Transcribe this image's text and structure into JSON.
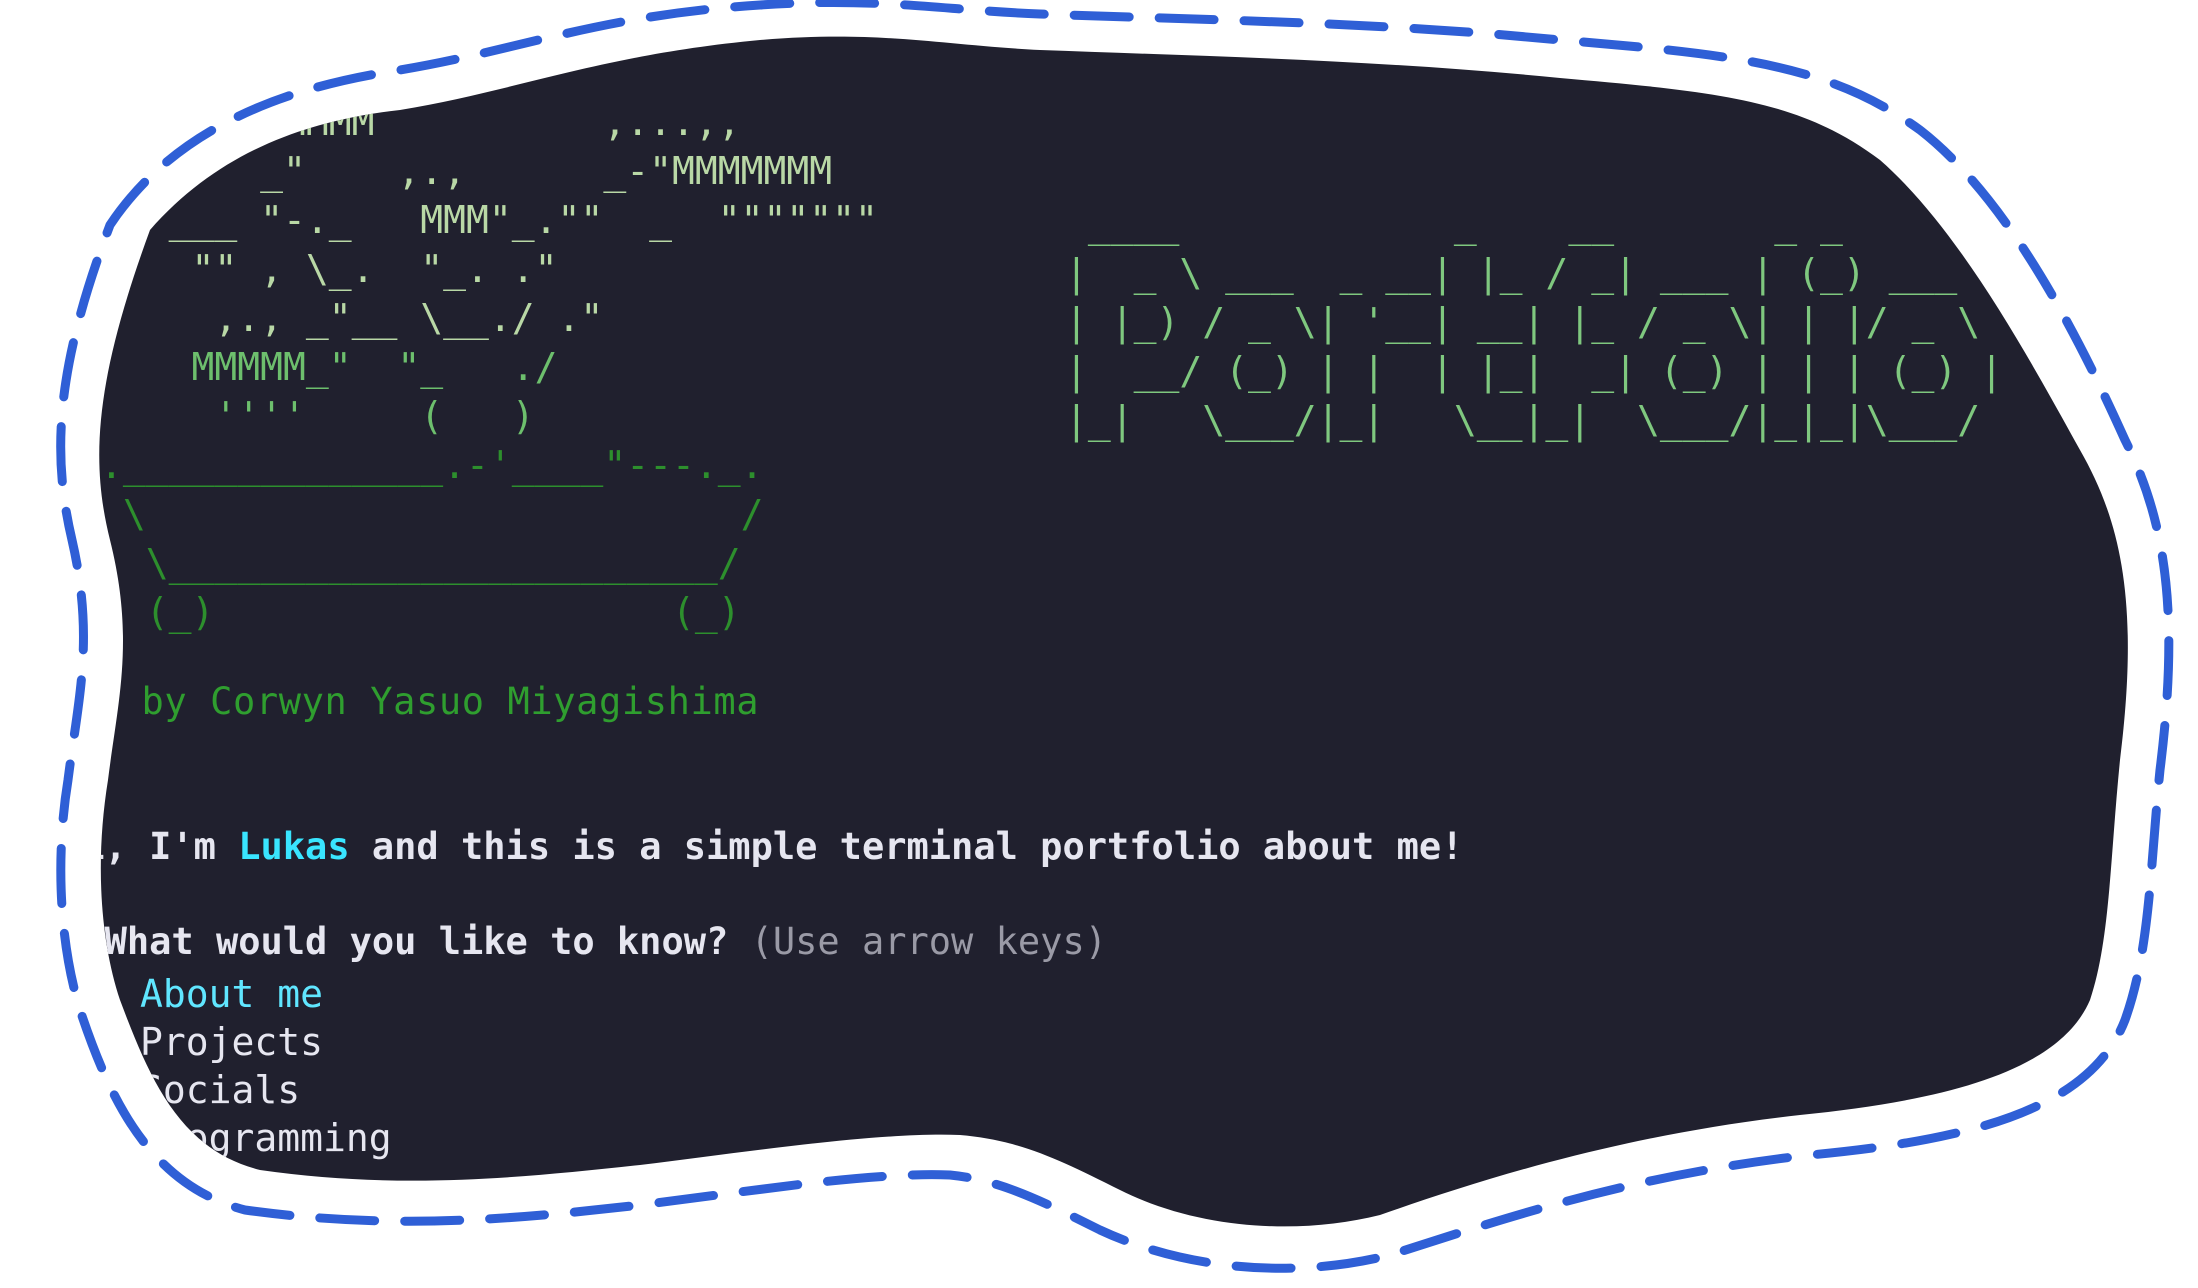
{
  "colors": {
    "terminal_bg": "#20202e",
    "tear_border": "#2f5fd6",
    "ascii_green": "#2d8f2d",
    "name_highlight": "#39e5ff",
    "selected_item": "#60e6ff"
  },
  "ascii_art": {
    "bonsai_lines": [
      "        MMMM          ,...,,",
      "       _\"    ,.,      _-\"MMMMMMM",
      "   ___ \"-._   MMM\"_.\"\"  _  \"\"\"\"\"\"\"",
      "\"   \"\" , \\_.  \"_. .\"",
      "     ,., _\"__ \\__./ .\"",
      "    MMMMM_\"  \"_   ./",
      "     ''''     (   )",
      ".______________.-'____\"---._.",
      " \\                          /",
      "  \\________________________/",
      "  (_)                    (_)"
    ],
    "banner_lines": [
      " ____            _    __       _ _",
      "|  _ \\ ___  _ __| |_ / _| ___ | (_) ___",
      "| |_) / _ \\| '__| __| |_ / _ \\| | |/ _ \\",
      "|  __/ (_) | |  | |_|  _| (_) | | | (_) |",
      "|_|   \\___/|_|   \\__|_|  \\___/|_|_|\\___/"
    ],
    "credit": "Art by Corwyn Yasuo Miyagishima"
  },
  "intro": {
    "prefix": "Hi, I'm ",
    "name": "Lukas",
    "suffix": " and this is a simple terminal portfolio about me!"
  },
  "prompt": {
    "marker": "?",
    "question": "What would you like to know?",
    "hint": "(Use arrow keys)"
  },
  "menu": {
    "pointer": "❯",
    "items": [
      {
        "label": "About me",
        "selected": true
      },
      {
        "label": "Projects",
        "selected": false
      },
      {
        "label": "Socials",
        "selected": false
      },
      {
        "label": "Programming",
        "selected": false
      }
    ]
  }
}
